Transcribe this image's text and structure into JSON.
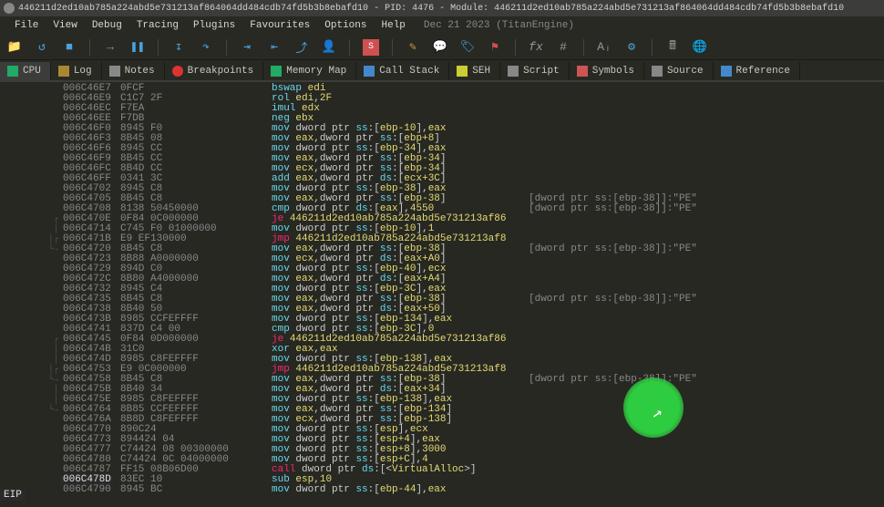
{
  "title": "446211d2ed10ab785a224abd5e731213af864064dd484cdb74fd5b3b8ebafd10 - PID: 4476 - Module: 446211d2ed10ab785a224abd5e731213af864064dd484cdb74fd5b3b8ebafd10",
  "menus": [
    "File",
    "View",
    "Debug",
    "Tracing",
    "Plugins",
    "Favourites",
    "Options",
    "Help"
  ],
  "date": "Dec 21 2023 (TitanEngine)",
  "tabs": [
    {
      "label": "CPU",
      "active": true
    },
    {
      "label": "Log"
    },
    {
      "label": "Notes"
    },
    {
      "label": "Breakpoints"
    },
    {
      "label": "Memory Map"
    },
    {
      "label": "Call Stack"
    },
    {
      "label": "SEH"
    },
    {
      "label": "Script"
    },
    {
      "label": "Symbols"
    },
    {
      "label": "Source"
    },
    {
      "label": "Reference"
    }
  ],
  "eip_label": "EIP",
  "rows": [
    {
      "addr": "006C46E7",
      "bytes": "0FCF",
      "m": "bswap",
      "ops": [
        {
          "t": "reg",
          "v": "edi"
        }
      ]
    },
    {
      "addr": "006C46E9",
      "bytes": "C1C7 2F",
      "m": "rol",
      "ops": [
        {
          "t": "reg",
          "v": "edi"
        },
        {
          "t": "num",
          "v": "2F"
        }
      ]
    },
    {
      "addr": "006C46EC",
      "bytes": "F7EA",
      "m": "imul",
      "ops": [
        {
          "t": "reg",
          "v": "edx"
        }
      ]
    },
    {
      "addr": "006C46EE",
      "bytes": "F7DB",
      "m": "neg",
      "ops": [
        {
          "t": "reg",
          "v": "ebx"
        }
      ]
    },
    {
      "addr": "006C46F0",
      "bytes": "8945 F0",
      "m": "mov",
      "ops": [
        {
          "t": "mem",
          "seg": "ss",
          "base": "ebp",
          "off": "-10"
        },
        {
          "t": "reg",
          "v": "eax"
        }
      ]
    },
    {
      "addr": "006C46F3",
      "bytes": "8B45 08",
      "m": "mov",
      "ops": [
        {
          "t": "reg",
          "v": "eax"
        },
        {
          "t": "mem",
          "seg": "ss",
          "base": "ebp",
          "off": "+8"
        }
      ]
    },
    {
      "addr": "006C46F6",
      "bytes": "8945 CC",
      "m": "mov",
      "ops": [
        {
          "t": "mem",
          "seg": "ss",
          "base": "ebp",
          "off": "-34"
        },
        {
          "t": "reg",
          "v": "eax"
        }
      ]
    },
    {
      "addr": "006C46F9",
      "bytes": "8B45 CC",
      "m": "mov",
      "ops": [
        {
          "t": "reg",
          "v": "eax"
        },
        {
          "t": "mem",
          "seg": "ss",
          "base": "ebp",
          "off": "-34"
        }
      ]
    },
    {
      "addr": "006C46FC",
      "bytes": "8B4D CC",
      "m": "mov",
      "ops": [
        {
          "t": "reg",
          "v": "ecx"
        },
        {
          "t": "mem",
          "seg": "ss",
          "base": "ebp",
          "off": "-34"
        }
      ]
    },
    {
      "addr": "006C46FF",
      "bytes": "0341 3C",
      "m": "add",
      "ops": [
        {
          "t": "reg",
          "v": "eax"
        },
        {
          "t": "mem",
          "seg": "ds",
          "base": "ecx",
          "off": "+3C"
        }
      ]
    },
    {
      "addr": "006C4702",
      "bytes": "8945 C8",
      "m": "mov",
      "ops": [
        {
          "t": "mem",
          "seg": "ss",
          "base": "ebp",
          "off": "-38"
        },
        {
          "t": "reg",
          "v": "eax"
        }
      ]
    },
    {
      "addr": "006C4705",
      "bytes": "8B45 C8",
      "m": "mov",
      "ops": [
        {
          "t": "reg",
          "v": "eax"
        },
        {
          "t": "mem",
          "seg": "ss",
          "base": "ebp",
          "off": "-38"
        }
      ],
      "cmt": "[dword ptr ss:[ebp-38]]:\"PE\""
    },
    {
      "addr": "006C4708",
      "bytes": "8138 50450000",
      "m": "cmp",
      "ops": [
        {
          "t": "mem",
          "seg": "ds",
          "base": "eax"
        },
        {
          "t": "num",
          "v": "4550"
        }
      ],
      "cmt": "[dword ptr ss:[ebp-38]]:\"PE\""
    },
    {
      "addr": "006C470E",
      "bytes": "0F84 0C000000",
      "m": "je",
      "jmp": true,
      "ops": [
        {
          "t": "addr",
          "v": "446211d2ed10ab785a224abd5e731213af86"
        }
      ],
      "jsrc": "┌"
    },
    {
      "addr": "006C4714",
      "bytes": "C745 F0 01000000",
      "m": "mov",
      "ops": [
        {
          "t": "mem",
          "seg": "ss",
          "base": "ebp",
          "off": "-10"
        },
        {
          "t": "num",
          "v": "1"
        }
      ],
      "jsrc": "│"
    },
    {
      "addr": "006C471B",
      "bytes": "E9 EF130000",
      "m": "jmp",
      "jmp": true,
      "ops": [
        {
          "t": "addr",
          "v": "446211d2ed10ab785a224abd5e731213af8"
        }
      ],
      "jsrc": "│┌"
    },
    {
      "addr": "006C4720",
      "bytes": "8B45 C8",
      "m": "mov",
      "ops": [
        {
          "t": "reg",
          "v": "eax"
        },
        {
          "t": "mem",
          "seg": "ss",
          "base": "ebp",
          "off": "-38"
        }
      ],
      "cmt": "[dword ptr ss:[ebp-38]]:\"PE\"",
      "jsrc": "└→"
    },
    {
      "addr": "006C4723",
      "bytes": "8B88 A0000000",
      "m": "mov",
      "ops": [
        {
          "t": "reg",
          "v": "ecx"
        },
        {
          "t": "mem",
          "seg": "ds",
          "base": "eax",
          "off": "+A0"
        }
      ]
    },
    {
      "addr": "006C4729",
      "bytes": "894D C0",
      "m": "mov",
      "ops": [
        {
          "t": "mem",
          "seg": "ss",
          "base": "ebp",
          "off": "-40"
        },
        {
          "t": "reg",
          "v": "ecx"
        }
      ]
    },
    {
      "addr": "006C472C",
      "bytes": "8B80 A4000000",
      "m": "mov",
      "ops": [
        {
          "t": "reg",
          "v": "eax"
        },
        {
          "t": "mem",
          "seg": "ds",
          "base": "eax",
          "off": "+A4"
        }
      ]
    },
    {
      "addr": "006C4732",
      "bytes": "8945 C4",
      "m": "mov",
      "ops": [
        {
          "t": "mem",
          "seg": "ss",
          "base": "ebp",
          "off": "-3C"
        },
        {
          "t": "reg",
          "v": "eax"
        }
      ]
    },
    {
      "addr": "006C4735",
      "bytes": "8B45 C8",
      "m": "mov",
      "ops": [
        {
          "t": "reg",
          "v": "eax"
        },
        {
          "t": "mem",
          "seg": "ss",
          "base": "ebp",
          "off": "-38"
        }
      ],
      "cmt": "[dword ptr ss:[ebp-38]]:\"PE\""
    },
    {
      "addr": "006C4738",
      "bytes": "8B40 50",
      "m": "mov",
      "ops": [
        {
          "t": "reg",
          "v": "eax"
        },
        {
          "t": "mem",
          "seg": "ds",
          "base": "eax",
          "off": "+50"
        }
      ]
    },
    {
      "addr": "006C473B",
      "bytes": "8985 CCFEFFFF",
      "m": "mov",
      "ops": [
        {
          "t": "mem",
          "seg": "ss",
          "base": "ebp",
          "off": "-134"
        },
        {
          "t": "reg",
          "v": "eax"
        }
      ]
    },
    {
      "addr": "006C4741",
      "bytes": "837D C4 00",
      "m": "cmp",
      "ops": [
        {
          "t": "mem",
          "seg": "ss",
          "base": "ebp",
          "off": "-3C"
        },
        {
          "t": "num",
          "v": "0"
        }
      ]
    },
    {
      "addr": "006C4745",
      "bytes": "0F84 0D000000",
      "m": "je",
      "jmp": true,
      "ops": [
        {
          "t": "addr",
          "v": "446211d2ed10ab785a224abd5e731213af86"
        }
      ],
      "jsrc": "┌"
    },
    {
      "addr": "006C474B",
      "bytes": "31C0",
      "m": "xor",
      "ops": [
        {
          "t": "reg",
          "v": "eax"
        },
        {
          "t": "reg",
          "v": "eax"
        }
      ],
      "jsrc": "│"
    },
    {
      "addr": "006C474D",
      "bytes": "8985 C8FEFFFF",
      "m": "mov",
      "ops": [
        {
          "t": "mem",
          "seg": "ss",
          "base": "ebp",
          "off": "-138"
        },
        {
          "t": "reg",
          "v": "eax"
        }
      ],
      "jsrc": "│"
    },
    {
      "addr": "006C4753",
      "bytes": "E9 0C000000",
      "m": "jmp",
      "jmp": true,
      "ops": [
        {
          "t": "addr",
          "v": "446211d2ed10ab785a224abd5e731213af8"
        }
      ],
      "jsrc": "│┌"
    },
    {
      "addr": "006C4758",
      "bytes": "8B45 C8",
      "m": "mov",
      "ops": [
        {
          "t": "reg",
          "v": "eax"
        },
        {
          "t": "mem",
          "seg": "ss",
          "base": "ebp",
          "off": "-38"
        }
      ],
      "cmt": "[dword ptr ss:[ebp-38]]:\"PE\"",
      "jsrc": "└→"
    },
    {
      "addr": "006C475B",
      "bytes": "8B40 34",
      "m": "mov",
      "ops": [
        {
          "t": "reg",
          "v": "eax"
        },
        {
          "t": "mem",
          "seg": "ds",
          "base": "eax",
          "off": "+34"
        }
      ],
      "jsrc": "│"
    },
    {
      "addr": "006C475E",
      "bytes": "8985 C8FEFFFF",
      "m": "mov",
      "ops": [
        {
          "t": "mem",
          "seg": "ss",
          "base": "ebp",
          "off": "-138"
        },
        {
          "t": "reg",
          "v": "eax"
        }
      ],
      "jsrc": "│"
    },
    {
      "addr": "006C4764",
      "bytes": "8B85 CCFEFFFF",
      "m": "mov",
      "ops": [
        {
          "t": "reg",
          "v": "eax"
        },
        {
          "t": "mem",
          "seg": "ss",
          "base": "ebp",
          "off": "-134"
        }
      ],
      "jsrc": "└→"
    },
    {
      "addr": "006C476A",
      "bytes": "8B8D C8FEFFFF",
      "m": "mov",
      "ops": [
        {
          "t": "reg",
          "v": "ecx"
        },
        {
          "t": "mem",
          "seg": "ss",
          "base": "ebp",
          "off": "-138"
        }
      ]
    },
    {
      "addr": "006C4770",
      "bytes": "890C24",
      "m": "mov",
      "ops": [
        {
          "t": "mem",
          "seg": "ss",
          "base": "esp"
        },
        {
          "t": "reg",
          "v": "ecx"
        }
      ]
    },
    {
      "addr": "006C4773",
      "bytes": "894424 04",
      "m": "mov",
      "ops": [
        {
          "t": "mem",
          "seg": "ss",
          "base": "esp",
          "off": "+4"
        },
        {
          "t": "reg",
          "v": "eax"
        }
      ]
    },
    {
      "addr": "006C4777",
      "bytes": "C74424 08 00300000",
      "m": "mov",
      "ops": [
        {
          "t": "mem",
          "seg": "ss",
          "base": "esp",
          "off": "+8"
        },
        {
          "t": "num",
          "v": "3000"
        }
      ]
    },
    {
      "addr": "006C4780",
      "bytes": "C74424 0C 04000000",
      "m": "mov",
      "ops": [
        {
          "t": "mem",
          "seg": "ss",
          "base": "esp",
          "off": "+C"
        },
        {
          "t": "num",
          "v": "4"
        }
      ]
    },
    {
      "addr": "006C4787",
      "bytes": "FF15 08B06D00",
      "m": "call",
      "jmp": true,
      "ops": [
        {
          "t": "call",
          "v": "VirtualAlloc"
        }
      ]
    },
    {
      "addr": "006C478D",
      "bytes": "83EC 10",
      "m": "sub",
      "ops": [
        {
          "t": "reg",
          "v": "esp"
        },
        {
          "t": "num",
          "v": "10"
        }
      ],
      "eip": true
    },
    {
      "addr": "006C4790",
      "bytes": "8945 BC",
      "m": "mov",
      "ops": [
        {
          "t": "mem",
          "seg": "ss",
          "base": "ebp",
          "off": "-44"
        },
        {
          "t": "reg",
          "v": "eax"
        }
      ]
    }
  ]
}
